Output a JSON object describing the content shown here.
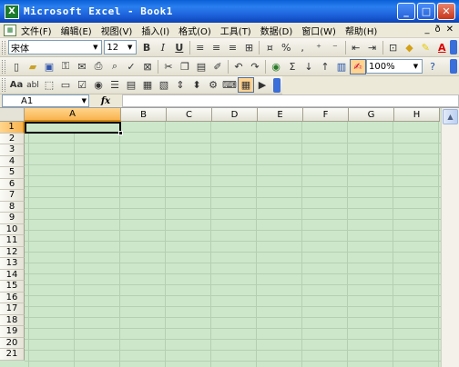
{
  "window": {
    "title": "Microsoft Excel - Book1",
    "icon_label": "X",
    "controls": {
      "minimize": "_",
      "maximize": "□",
      "close": "✕"
    }
  },
  "menu": {
    "items": [
      "文件(F)",
      "编辑(E)",
      "视图(V)",
      "插入(I)",
      "格式(O)",
      "工具(T)",
      "数据(D)",
      "窗口(W)",
      "帮助(H)"
    ],
    "right": {
      "minimize": "_",
      "restore": "ð",
      "close": "✕"
    }
  },
  "formatting_toolbar": {
    "font_name": "宋体",
    "font_size": "12",
    "bold": "B",
    "italic": "I",
    "underline": "U",
    "percent": "%",
    "comma": ",",
    "font_color_label": "A"
  },
  "standard_toolbar": {
    "sum": "Σ",
    "zoom": "100%"
  },
  "forms_toolbar": {
    "label_btn": "Aa",
    "edit_btn": "abl"
  },
  "formula_bar": {
    "name_box": "A1",
    "fx": "fx",
    "formula_value": ""
  },
  "grid": {
    "columns": [
      "A",
      "B",
      "C",
      "D",
      "E",
      "F",
      "G",
      "H"
    ],
    "rows": [
      "1",
      "2",
      "3",
      "4",
      "5",
      "6",
      "7",
      "8",
      "9",
      "10",
      "11",
      "12",
      "13",
      "14",
      "15",
      "16",
      "17",
      "18",
      "19",
      "20",
      "21"
    ],
    "selected_cell": "A1"
  },
  "colors": {
    "title_bar": "#2a7ff0",
    "grid_background": "#cde7cb",
    "selection_header": "#f9b34f"
  }
}
